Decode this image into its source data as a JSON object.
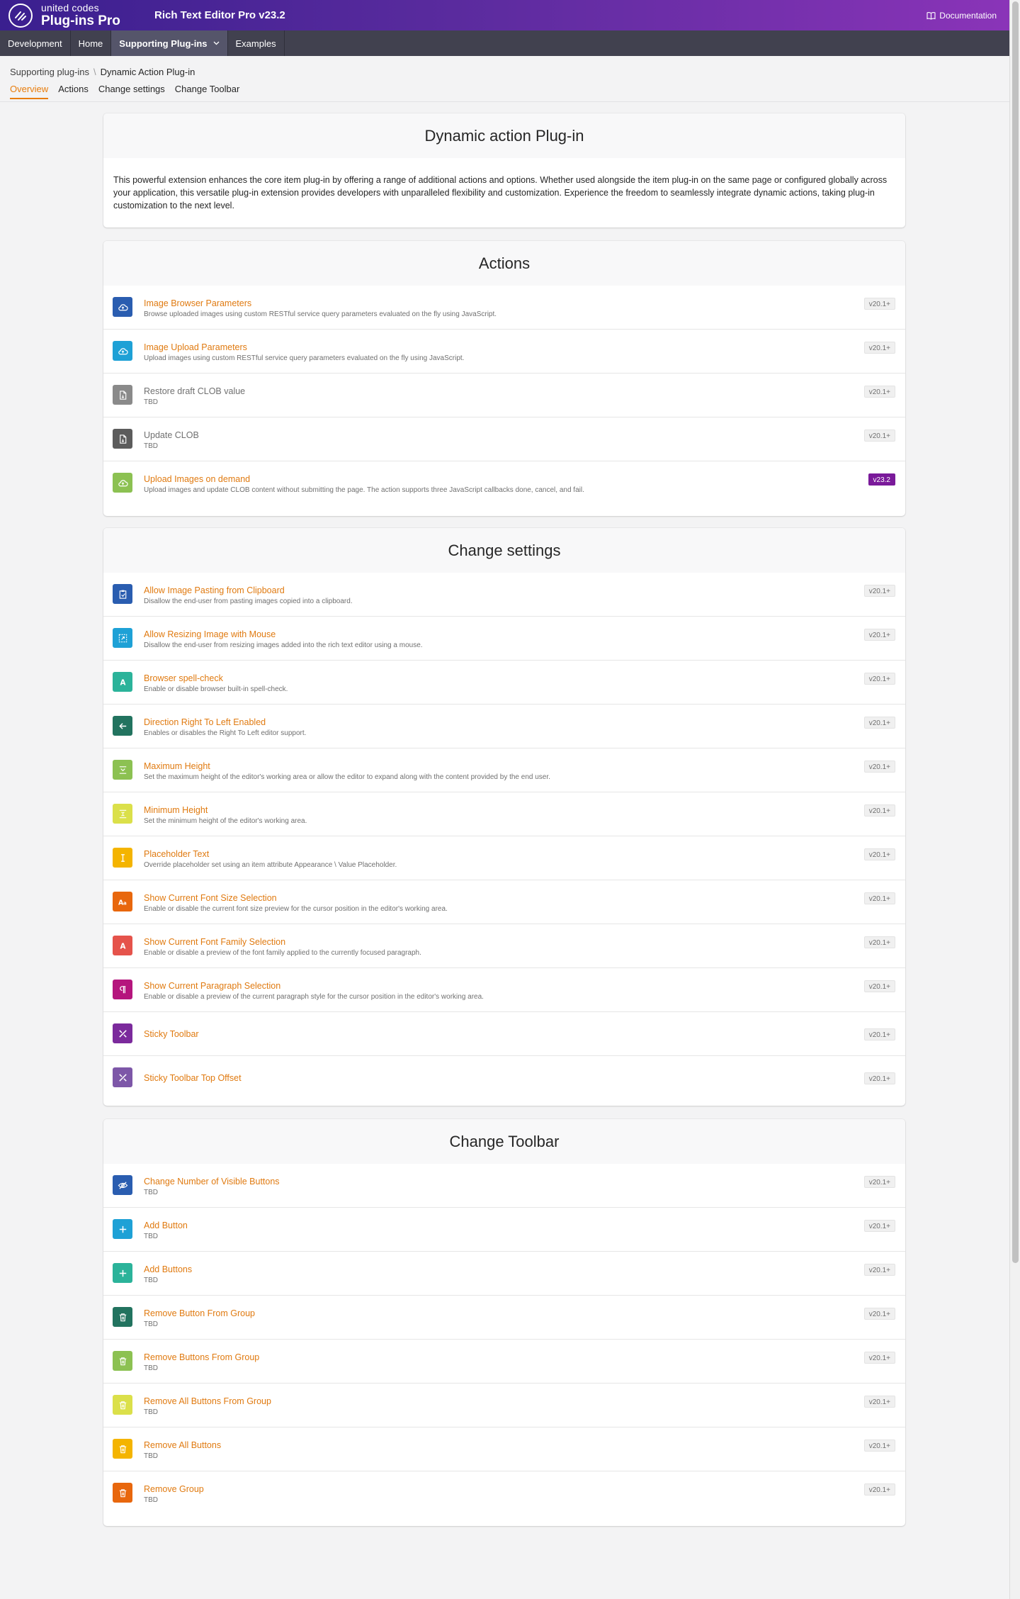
{
  "header": {
    "logo_small": "united codes",
    "logo_big": "Plug-ins Pro",
    "app_title": "Rich Text Editor Pro v23.2",
    "doc_link": "Documentation"
  },
  "nav": {
    "items": [
      {
        "label": "Development"
      },
      {
        "label": "Home"
      },
      {
        "label": "Supporting Plug-ins"
      },
      {
        "label": "Examples"
      }
    ]
  },
  "breadcrumb": {
    "parent": "Supporting plug-ins",
    "separator": "\\",
    "current": "Dynamic Action Plug-in"
  },
  "tabs": [
    {
      "label": "Overview"
    },
    {
      "label": "Actions"
    },
    {
      "label": "Change settings"
    },
    {
      "label": "Change Toolbar"
    }
  ],
  "intro": {
    "title": "Dynamic action Plug-in",
    "text": "This powerful extension enhances the core item plug-in by offering a range of additional actions and options. Whether used alongside the item plug-in on the same page or configured globally across your application, this versatile plug-in extension provides developers with unparalleled flexibility and customization. Experience the freedom to seamlessly integrate dynamic actions, taking plug-in customization to the next level."
  },
  "sections": {
    "actions": {
      "title": "Actions",
      "items": [
        {
          "title": "Image Browser Parameters",
          "desc": "Browse uploaded images using custom RESTful service query parameters evaluated on the fly using JavaScript.",
          "badge": "v20.1+",
          "icon": "cloud-icon",
          "color": "#2a5db0"
        },
        {
          "title": "Image Upload Parameters",
          "desc": "Upload images using custom RESTful service query parameters evaluated on the fly using JavaScript.",
          "badge": "v20.1+",
          "icon": "cloud-icon",
          "color": "#1ea1d6"
        },
        {
          "title": "Restore draft CLOB value",
          "desc": "TBD",
          "badge": "v20.1+",
          "icon": "file-icon",
          "color": "#8a8a8a"
        },
        {
          "title": "Update CLOB",
          "desc": "TBD",
          "badge": "v20.1+",
          "icon": "file-icon",
          "color": "#5c5c5c"
        },
        {
          "title": "Upload Images on demand",
          "desc": "Upload images and update CLOB content without submitting the page. The action supports three JavaScript callbacks done, cancel, and fail.",
          "badge": "v23.2",
          "icon": "cloud-icon",
          "color": "#8cc152"
        }
      ]
    },
    "settings": {
      "title": "Change settings",
      "items": [
        {
          "title": "Allow Image Pasting from Clipboard",
          "desc": "Disallow the end-user from pasting images copied into a clipboard.",
          "badge": "v20.1+",
          "icon": "clipboard-icon",
          "color": "#2a5db0"
        },
        {
          "title": "Allow Resizing Image with Mouse",
          "desc": "Disallow the end-user from resizing images added into the rich text editor using a mouse.",
          "badge": "v20.1+",
          "icon": "resize-icon",
          "color": "#1ea1d6"
        },
        {
          "title": "Browser spell-check",
          "desc": "Enable or disable browser built-in spell-check.",
          "badge": "v20.1+",
          "icon": "letter-a-icon",
          "color": "#2bb39a"
        },
        {
          "title": "Direction Right To Left Enabled",
          "desc": "Enables or disables the Right To Left editor support.",
          "badge": "v20.1+",
          "icon": "arrow-left-icon",
          "color": "#22735f"
        },
        {
          "title": "Maximum Height",
          "desc": "Set the maximum height of the editor's working area or allow the editor to expand along with the content provided by the end user.",
          "badge": "v20.1+",
          "icon": "max-height-icon",
          "color": "#8cc152"
        },
        {
          "title": "Minimum Height",
          "desc": "Set the minimum height of the editor's working area.",
          "badge": "v20.1+",
          "icon": "min-height-icon",
          "color": "#dbe04a"
        },
        {
          "title": "Placeholder Text",
          "desc": "Override placeholder set using an item attribute Appearance \\ Value Placeholder.",
          "badge": "v20.1+",
          "icon": "text-cursor-icon",
          "color": "#f4b400"
        },
        {
          "title": "Show Current Font Size Selection",
          "desc": "Enable or disable the current font size preview for the cursor position in the editor's working area.",
          "badge": "v20.1+",
          "icon": "font-size-icon",
          "color": "#e8670d"
        },
        {
          "title": "Show Current Font Family Selection",
          "desc": "Enable or disable a preview of the font family applied to the currently focused paragraph.",
          "badge": "v20.1+",
          "icon": "letter-a-icon",
          "color": "#e5534b"
        },
        {
          "title": "Show Current Paragraph Selection",
          "desc": "Enable or disable a preview of the current paragraph style for the cursor position in the editor's working area.",
          "badge": "v20.1+",
          "icon": "paragraph-icon",
          "color": "#b5157d"
        },
        {
          "title": "Sticky Toolbar",
          "desc": "",
          "badge": "v20.1+",
          "icon": "tools-icon",
          "color": "#7b2a9c"
        },
        {
          "title": "Sticky Toolbar Top Offset",
          "desc": "",
          "badge": "v20.1+",
          "icon": "tools-icon",
          "color": "#7d57a8"
        }
      ]
    },
    "toolbar": {
      "title": "Change Toolbar",
      "items": [
        {
          "title": "Change Number of Visible Buttons",
          "desc": "TBD",
          "badge": "v20.1+",
          "icon": "eye-slash-icon",
          "color": "#2a5db0"
        },
        {
          "title": "Add Button",
          "desc": "TBD",
          "badge": "v20.1+",
          "icon": "plus-icon",
          "color": "#1ea1d6"
        },
        {
          "title": "Add Buttons",
          "desc": "TBD",
          "badge": "v20.1+",
          "icon": "plus-icon",
          "color": "#2bb39a"
        },
        {
          "title": "Remove Button From Group",
          "desc": "TBD",
          "badge": "v20.1+",
          "icon": "trash-icon",
          "color": "#22735f"
        },
        {
          "title": "Remove Buttons From Group",
          "desc": "TBD",
          "badge": "v20.1+",
          "icon": "trash-icon",
          "color": "#8cc152"
        },
        {
          "title": "Remove All Buttons From Group",
          "desc": "TBD",
          "badge": "v20.1+",
          "icon": "trash-icon",
          "color": "#dbe04a"
        },
        {
          "title": "Remove All Buttons",
          "desc": "TBD",
          "badge": "v20.1+",
          "icon": "trash-icon",
          "color": "#f4b400"
        },
        {
          "title": "Remove Group",
          "desc": "TBD",
          "badge": "v20.1+",
          "icon": "trash-icon",
          "color": "#e8670d"
        }
      ]
    }
  },
  "colors": {
    "accent": "#e07a10",
    "header_start": "#3a1f8f",
    "header_end": "#8a34b8",
    "nav_bg": "#41414f",
    "badge_highlight": "#7a1a9a"
  }
}
